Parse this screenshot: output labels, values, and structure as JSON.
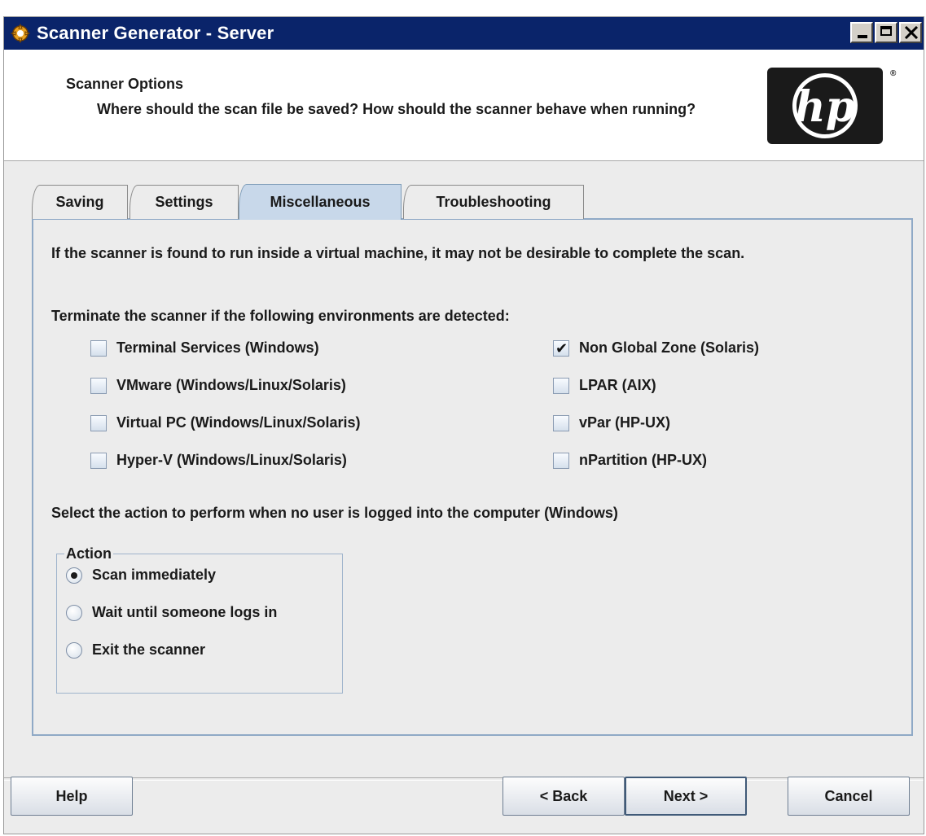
{
  "window": {
    "title": "Scanner Generator - Server"
  },
  "header": {
    "title": "Scanner Options",
    "description": "Where should the scan file be saved?  How should the scanner behave when running?"
  },
  "tabs": [
    {
      "label": "Saving",
      "active": false
    },
    {
      "label": "Settings",
      "active": false
    },
    {
      "label": "Miscellaneous",
      "active": true
    },
    {
      "label": "Troubleshooting",
      "active": false
    }
  ],
  "panel": {
    "intro": "If the scanner is found to run inside a virtual machine, it may not be desirable to complete the scan.",
    "terminate_label": "Terminate the scanner if the following environments are detected:",
    "environments": [
      {
        "label": "Terminal Services (Windows)",
        "checked": false
      },
      {
        "label": "VMware (Windows/Linux/Solaris)",
        "checked": false
      },
      {
        "label": "Virtual PC (Windows/Linux/Solaris)",
        "checked": false
      },
      {
        "label": "Hyper-V (Windows/Linux/Solaris)",
        "checked": false
      },
      {
        "label": "Non Global Zone (Solaris)",
        "checked": true
      },
      {
        "label": "LPAR (AIX)",
        "checked": false
      },
      {
        "label": "vPar (HP-UX)",
        "checked": false
      },
      {
        "label": "nPartition (HP-UX)",
        "checked": false
      }
    ],
    "action_prompt": "Select the action to perform when no user is logged into the computer (Windows)",
    "action_group_label": "Action",
    "actions": [
      {
        "label": "Scan immediately",
        "selected": true
      },
      {
        "label": "Wait until someone logs in",
        "selected": false
      },
      {
        "label": "Exit the scanner",
        "selected": false
      }
    ]
  },
  "buttons": {
    "help": "Help",
    "back": "< Back",
    "next": "Next >",
    "cancel": "Cancel"
  },
  "logo": {
    "text": "hp",
    "registered_mark": "®"
  },
  "colors": {
    "titlebar": "#0a246a",
    "active_tab": "#c8d8ea",
    "panel_border": "#8fa9c6"
  }
}
